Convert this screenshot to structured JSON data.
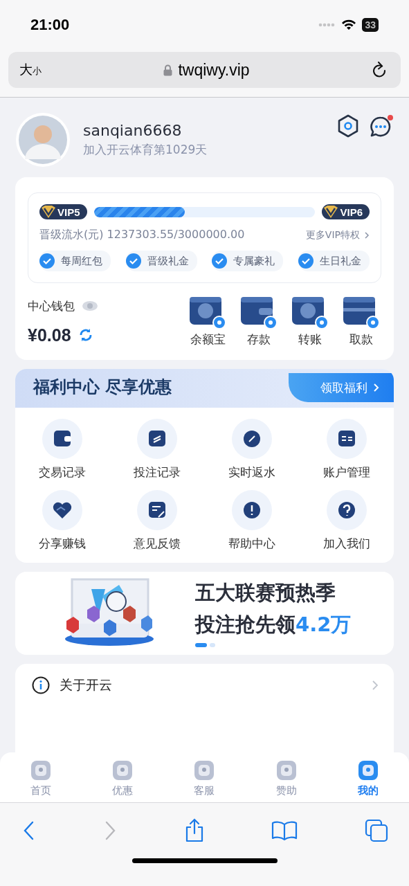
{
  "status_bar": {
    "time": "21:00",
    "battery": "33"
  },
  "browser": {
    "text_size_large": "大",
    "text_size_small": "小",
    "url": "twqiwy.vip"
  },
  "profile": {
    "username": "sanqian6668",
    "joined": "加入开云体育第1029天",
    "has_unread_message": true
  },
  "vip": {
    "current": "VIP5",
    "next": "VIP6",
    "level": 0.41,
    "turnover": "晋级流水(元) 1237303.55/3000000.00",
    "more": "更多VIP特权",
    "perks": [
      {
        "label": "每周红包",
        "checked": true
      },
      {
        "label": "晋级礼金",
        "checked": true
      },
      {
        "label": "专属豪礼",
        "checked": true
      },
      {
        "label": "生日礼金",
        "checked": true
      }
    ]
  },
  "wallet": {
    "title": "中心钱包",
    "balance": "¥0.08",
    "actions": [
      {
        "label": "余额宝"
      },
      {
        "label": "存款"
      },
      {
        "label": "转账"
      },
      {
        "label": "取款"
      }
    ]
  },
  "welfare": {
    "title": "福利中心 尽享优惠",
    "claim": "领取福利",
    "items": [
      {
        "label": "交易记录"
      },
      {
        "label": "投注记录"
      },
      {
        "label": "实时返水"
      },
      {
        "label": "账户管理"
      },
      {
        "label": "分享赚钱"
      },
      {
        "label": "意见反馈"
      },
      {
        "label": "帮助中心"
      },
      {
        "label": "加入我们"
      }
    ]
  },
  "banner": {
    "line1": "五大联赛预热季",
    "line2": "投注抢先领",
    "highlight": "4.2万",
    "dots": [
      {
        "selected": true
      },
      {
        "selected": false
      }
    ]
  },
  "menu": [
    {
      "label": "关于开云"
    }
  ],
  "tab_bar": [
    {
      "label": "首页",
      "selected": false
    },
    {
      "label": "优惠",
      "selected": false
    },
    {
      "label": "客服",
      "selected": false
    },
    {
      "label": "赞助",
      "selected": false
    },
    {
      "label": "我的",
      "selected": true
    }
  ],
  "toolbar": {
    "forward_disabled": true
  }
}
